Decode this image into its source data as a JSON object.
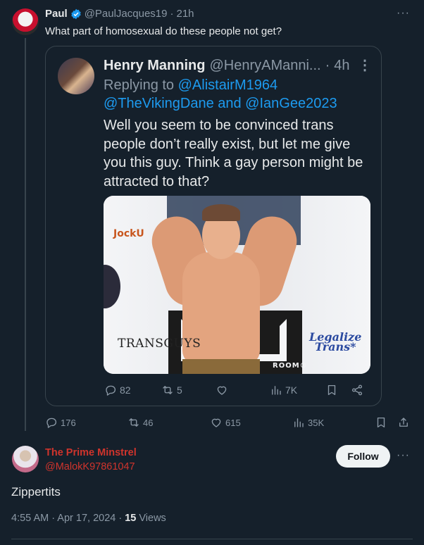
{
  "top_tweet": {
    "name": "Paul",
    "handle": "@PaulJacques19",
    "time": "21h",
    "text": "What part of homosexual do these people not get?",
    "more": "···",
    "stats": {
      "replies": "176",
      "retweets": "46",
      "likes": "615",
      "views": "35K"
    }
  },
  "quoted_tweet": {
    "name": "Henry Manning",
    "handle": "@HenryAManni...",
    "time": "4h",
    "more": "⋮",
    "replying_to_prefix": "Replying to",
    "replying_to_1": "@AlistairM1964",
    "replying_to_2": "@TheVikingDane and @IanGee2023",
    "text_lines": [
      "Well you seem to be convinced trans",
      "people don’t really exist, but let me give",
      "you this guy. Think a gay person might be",
      "attracted to that?"
    ],
    "stats": {
      "replies": "82",
      "retweets": "5",
      "views": "7K"
    },
    "photo_text": {
      "transguys": "TRANSGUYS",
      "legalize": "Legalize",
      "trans": "Trans*",
      "jock": "JockU",
      "room": "ROOM®"
    }
  },
  "reply": {
    "name": "The Prime Minstrel",
    "handle": "@MalokK97861047",
    "follow_label": "Follow",
    "more": "···",
    "text": "Zippertits",
    "timestamp": "4:55 AM · Apr 17, 2024 · ",
    "views_count": "15",
    "views_label": " Views"
  },
  "colors": {
    "background": "#15202b",
    "accent": "#1d9bf0",
    "reply_name": "#d0342c"
  },
  "icons": {
    "verified": "verified-badge-icon",
    "reply": "reply-icon",
    "retweet": "retweet-icon",
    "like": "heart-icon",
    "views": "views-bar-icon",
    "bookmark": "bookmark-icon",
    "share": "share-icon"
  }
}
